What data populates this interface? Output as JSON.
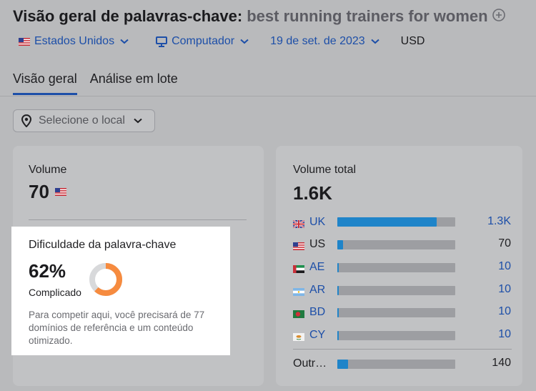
{
  "header": {
    "title": "Visão geral de palavras-chave:",
    "keyword": "best running trainers for women"
  },
  "filters": {
    "country": "Estados Unidos",
    "device": "Computador",
    "date": "19 de set. de 2023",
    "currency": "USD"
  },
  "tabs": [
    {
      "label": "Visão geral",
      "active": true
    },
    {
      "label": "Análise em lote",
      "active": false
    }
  ],
  "location_select": {
    "placeholder": "Selecione o local"
  },
  "volume_card": {
    "label": "Volume",
    "value": "70"
  },
  "keyword_difficulty": {
    "title": "Dificuldade da palavra-chave",
    "percent": "62%",
    "percent_value": 62,
    "level": "Complicado",
    "description": "Para competir aqui, você precisará de 77 domínios de referência e um conteúdo otimizado.",
    "color": "#f68b3f"
  },
  "total_volume_card": {
    "label": "Volume total",
    "value": "1.6K",
    "rows": [
      {
        "code": "UK",
        "value": "1.3K",
        "share": 0.84,
        "link": true
      },
      {
        "code": "US",
        "value": "70",
        "share": 0.05,
        "link": false
      },
      {
        "code": "AE",
        "value": "10",
        "share": 0.015,
        "link": true
      },
      {
        "code": "AR",
        "value": "10",
        "share": 0.015,
        "link": true
      },
      {
        "code": "BD",
        "value": "10",
        "share": 0.015,
        "link": true
      },
      {
        "code": "CY",
        "value": "10",
        "share": 0.015,
        "link": true
      }
    ],
    "others": {
      "label": "Outr…",
      "value": "140",
      "share": 0.09
    }
  },
  "colors": {
    "accent": "#1d4fa8",
    "bar": "#1f84c9",
    "difficulty": "#f68b3f"
  }
}
